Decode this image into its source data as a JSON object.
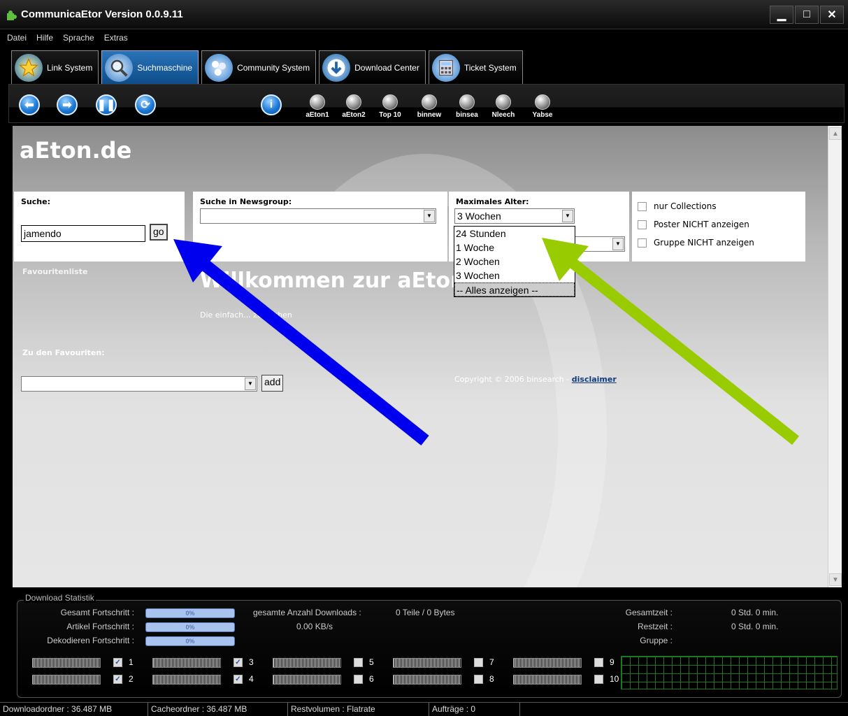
{
  "window": {
    "title": "CommunicaEtor Version 0.0.9.11"
  },
  "menu": [
    "Datei",
    "Hilfe",
    "Sprache",
    "Extras"
  ],
  "tabs": [
    {
      "label": "Link System",
      "icon": "star-icon"
    },
    {
      "label": "Suchmaschine",
      "icon": "magnifier-icon",
      "active": true
    },
    {
      "label": "Community System",
      "icon": "people-icon"
    },
    {
      "label": "Download Center",
      "icon": "download-icon"
    },
    {
      "label": "Ticket System",
      "icon": "calculator-icon"
    }
  ],
  "toolbar": {
    "engines": [
      "aEton1",
      "aEton2",
      "Top 10",
      "binnew",
      "binsea",
      "Nleech",
      "Yabse"
    ]
  },
  "page": {
    "site_title": "aEton.de",
    "search_label": "Suche:",
    "search_value": "jamendo",
    "go_label": "go",
    "newsgroup_label": "Suche in Newsgroup:",
    "newsgroup_value": "",
    "maxage_label": "Maximales Alter:",
    "maxage_value": "3 Wochen",
    "maxage_options": [
      "24 Stunden",
      "1 Woche",
      "2 Wochen",
      "3 Wochen",
      "-- Alles anzeigen --"
    ],
    "checkboxes": [
      "nur Collections",
      "Poster NICHT anzeigen",
      "Gruppe NICHT anzeigen"
    ],
    "favourites_label": "Favouritenliste",
    "welcome_text": "Willkommen zur aEton Suche",
    "welcome_sub": "Die einfach... zu suchen",
    "to_favourites_label": "Zu den Favouriten:",
    "add_label": "add",
    "copyright": "Copyright © 2006 binsearch -",
    "disclaimer": "disclaimer"
  },
  "stats": {
    "title": "Download Statistik",
    "gesamt_label": "Gesamt Fortschritt :",
    "artikel_label": "Artikel Fortschritt :",
    "dekodieren_label": "Dekodieren Fortschritt :",
    "progress_text": "0%",
    "progress": [
      0,
      0,
      0
    ],
    "downloads_label": "gesamte Anzahl Downloads :",
    "downloads_value": "0 Teile / 0 Bytes",
    "speed": "0.00 KB/s",
    "gesamtzeit_label": "Gesamtzeit :",
    "gesamtzeit_value": "0 Std. 0 min.",
    "restzeit_label": "Restzeit :",
    "restzeit_value": "0 Std. 0 min.",
    "gruppe_label": "Gruppe :",
    "slots": [
      {
        "num": "1",
        "checked": true
      },
      {
        "num": "2",
        "checked": true
      },
      {
        "num": "3",
        "checked": true
      },
      {
        "num": "4",
        "checked": true
      },
      {
        "num": "5",
        "checked": false
      },
      {
        "num": "6",
        "checked": false
      },
      {
        "num": "7",
        "checked": false
      },
      {
        "num": "8",
        "checked": false
      },
      {
        "num": "9",
        "checked": false
      },
      {
        "num": "10",
        "checked": false
      }
    ]
  },
  "statusbar": {
    "downloadordner": "Downloadordner :  36.487 MB",
    "cacheordner": "Cacheordner :  36.487 MB",
    "restvolumen": "Restvolumen : Flatrate",
    "auftraege": "Aufträge : 0"
  },
  "colors": {
    "blue_arrow": "#0000ee",
    "green_arrow": "#99cc00",
    "active_tab": "#1e64a8"
  }
}
